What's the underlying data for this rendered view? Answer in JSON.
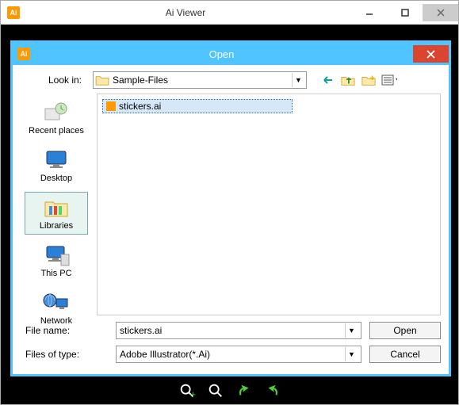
{
  "main": {
    "title": "Ai Viewer",
    "logo_text": "Ai"
  },
  "dialog": {
    "title": "Open",
    "logo_text": "Ai",
    "lookin_label": "Look in:",
    "lookin_value": "Sample-Files",
    "places": {
      "recent": "Recent places",
      "desktop": "Desktop",
      "libraries": "Libraries",
      "thispc": "This PC",
      "network": "Network"
    },
    "file_selected": "stickers.ai",
    "filename_label": "File name:",
    "filename_value": "stickers.ai",
    "filetype_label": "Files of type:",
    "filetype_value": "Adobe Illustrator(*.Ai)",
    "open_btn": "Open",
    "cancel_btn": "Cancel"
  }
}
